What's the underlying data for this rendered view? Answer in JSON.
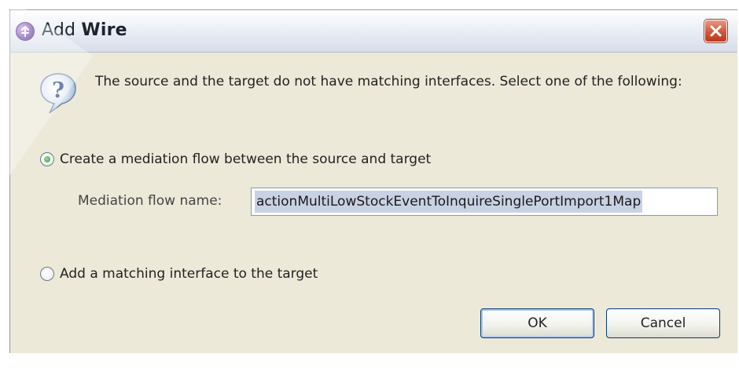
{
  "window": {
    "title_prefix": "Add",
    "title_bold": "Wire"
  },
  "message": "The source and the target do not have matching interfaces. Select one of the following:",
  "options": [
    {
      "label": "Create a mediation flow between the source and target",
      "checked": true
    },
    {
      "label": "Add a matching interface to the target",
      "checked": false
    }
  ],
  "mediation": {
    "label": "Mediation flow name:",
    "value": "actionMultiLowStockEventToInquireSinglePortImport1Map"
  },
  "buttons": {
    "ok": "OK",
    "cancel": "Cancel"
  },
  "icons": {
    "app": "app-icon",
    "close": "close-icon",
    "question": "question-icon"
  }
}
